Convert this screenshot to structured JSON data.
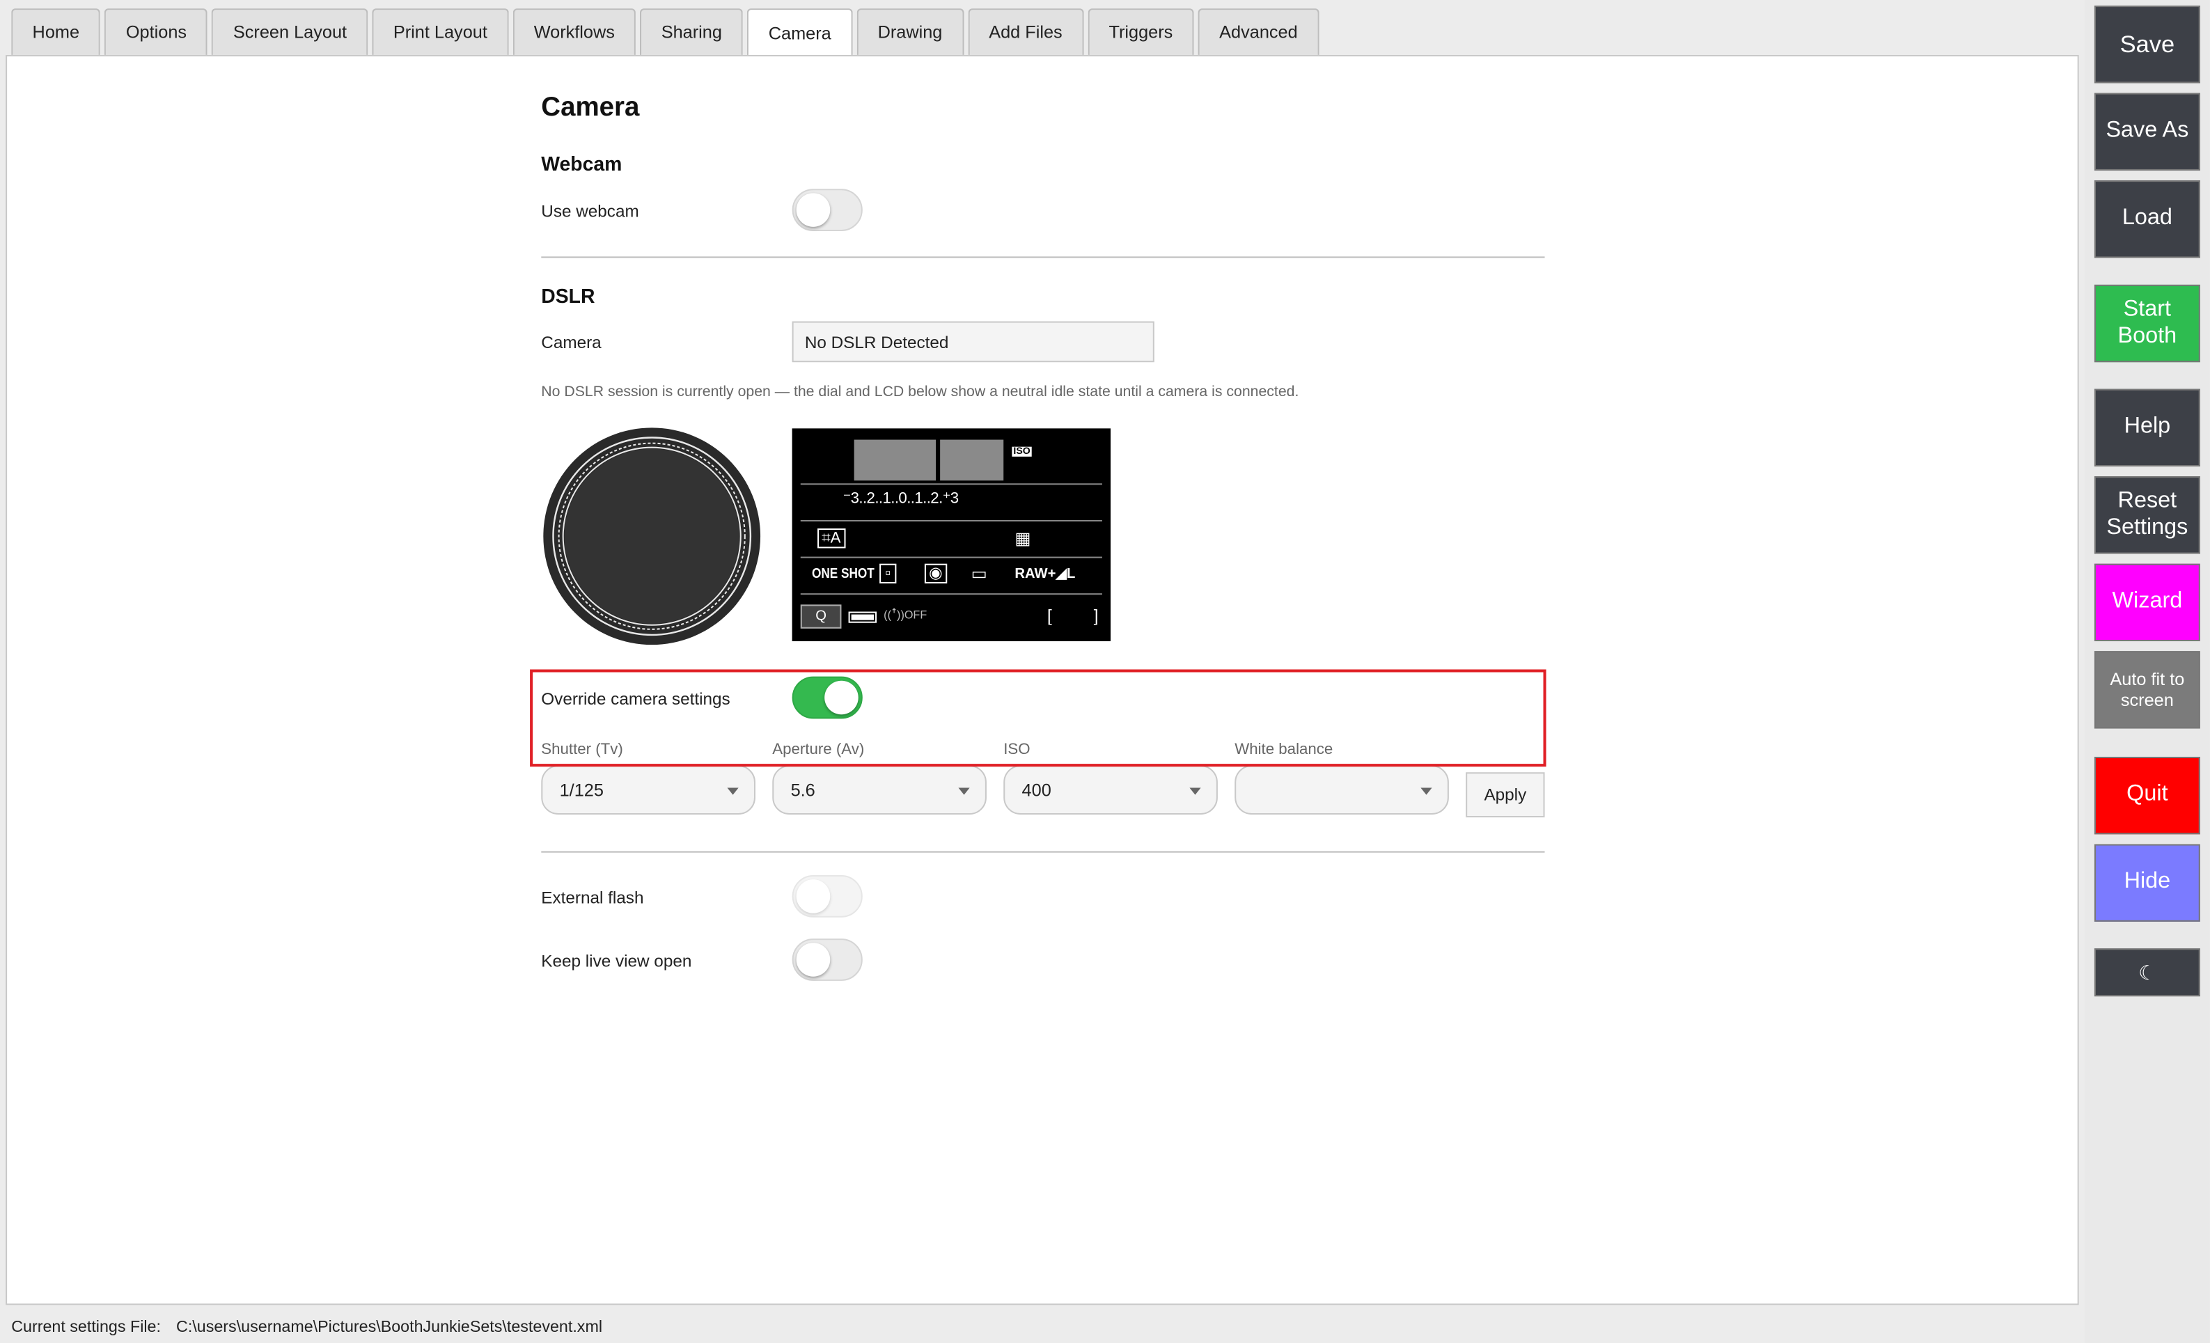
{
  "tabs": [
    {
      "label": "Home"
    },
    {
      "label": "Options"
    },
    {
      "label": "Screen Layout"
    },
    {
      "label": "Print Layout"
    },
    {
      "label": "Workflows"
    },
    {
      "label": "Sharing"
    },
    {
      "label": "Camera",
      "active": true
    },
    {
      "label": "Drawing"
    },
    {
      "label": "Add Files"
    },
    {
      "label": "Triggers"
    },
    {
      "label": "Advanced"
    }
  ],
  "page": {
    "title": "Camera",
    "webcam": {
      "heading": "Webcam",
      "use_label": "Use webcam",
      "use_on": false
    },
    "dslr": {
      "heading": "DSLR",
      "camera_label": "Camera",
      "camera_value": "No DSLR Detected",
      "note": "No DSLR session is currently open — the dial and LCD below show a neutral idle state until a camera is connected.",
      "lcd": {
        "iso_badge": "ISO",
        "exposure_scale": "⁻3..2..1..0..1..2.⁺3",
        "mode_icon": "⌗A",
        "wb_icon": "▦",
        "focus_mode": "ONE SHOT",
        "af_icon": "▫",
        "metering_icon": "◉",
        "drive_icon": "▭",
        "quality": "RAW+◢L",
        "q_button": "Q",
        "wifi": "((ꜛ))OFF",
        "shots_open": "[",
        "shots_close": "]"
      },
      "override_label": "Override camera settings",
      "override_on": true,
      "settings": {
        "shutter_label": "Shutter (Tv)",
        "shutter_value": "1/125",
        "aperture_label": "Aperture (Av)",
        "aperture_value": "5.6",
        "iso_label": "ISO",
        "iso_value": "400",
        "wb_label": "White balance",
        "wb_value": "",
        "apply_label": "Apply"
      }
    },
    "external_flash_label": "External flash",
    "external_flash_on": false,
    "live_view_label": "Keep live view open",
    "live_view_on": false
  },
  "status": {
    "label": "Current settings File:",
    "path": "C:\\users\\username\\Pictures\\BoothJunkieSets\\testevent.xml"
  },
  "sidebar": {
    "save": "Save",
    "save_as": "Save As",
    "load": "Load",
    "start_booth": "Start Booth",
    "help": "Help",
    "reset_settings": "Reset Settings",
    "wizard": "Wizard",
    "auto_fit": "Auto fit to screen",
    "quit": "Quit",
    "hide": "Hide",
    "night": "☾"
  },
  "colors": {
    "start_booth": "#2ebc50",
    "wizard": "#ff00ff",
    "quit": "#ff0000",
    "hide": "#7b7bff",
    "toggle_on": "#34b94f",
    "highlight": "#e01f25",
    "sidebar_dark": "#3d4047",
    "auto_fit": "#7b7b7b"
  }
}
